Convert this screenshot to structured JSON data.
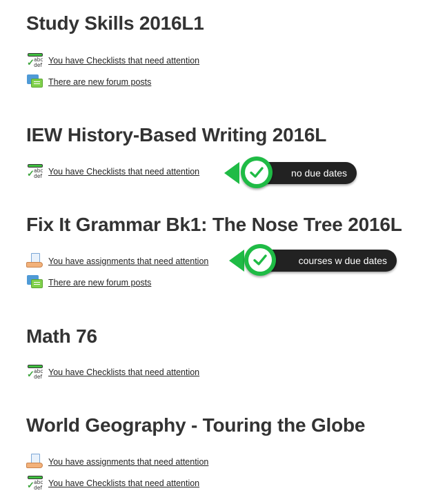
{
  "courses": [
    {
      "title": "Study Skills 2016L1",
      "notices": [
        {
          "icon": "checklist-icon",
          "text": "You have Checklists that need attention"
        },
        {
          "icon": "forum-icon",
          "text": "There are new forum posts"
        }
      ]
    },
    {
      "title": "IEW History-Based Writing 2016L",
      "notices": [
        {
          "icon": "checklist-icon",
          "text": "You have Checklists that need attention"
        }
      ]
    },
    {
      "title": "Fix It Grammar Bk1: The Nose Tree 2016L",
      "notices": [
        {
          "icon": "assignment-icon",
          "text": "You have assignments that need attention"
        },
        {
          "icon": "forum-icon",
          "text": "There are new forum posts"
        }
      ]
    },
    {
      "title": "Math 76",
      "notices": [
        {
          "icon": "checklist-icon",
          "text": "You have Checklists that need attention"
        }
      ]
    },
    {
      "title": "World Geography - Touring the Globe",
      "notices": [
        {
          "icon": "assignment-icon",
          "text": "You have assignments that need attention"
        },
        {
          "icon": "checklist-icon",
          "text": "You have Checklists that need attention"
        }
      ]
    }
  ],
  "callouts": {
    "no_due": {
      "label": "no due dates",
      "icon": "checkmark-icon"
    },
    "with_due": {
      "label": "courses w due dates",
      "icon": "checkmark-icon"
    }
  },
  "colors": {
    "badge_green": "#1fbb45",
    "pill_dark": "#222222",
    "title_text": "#333333"
  }
}
